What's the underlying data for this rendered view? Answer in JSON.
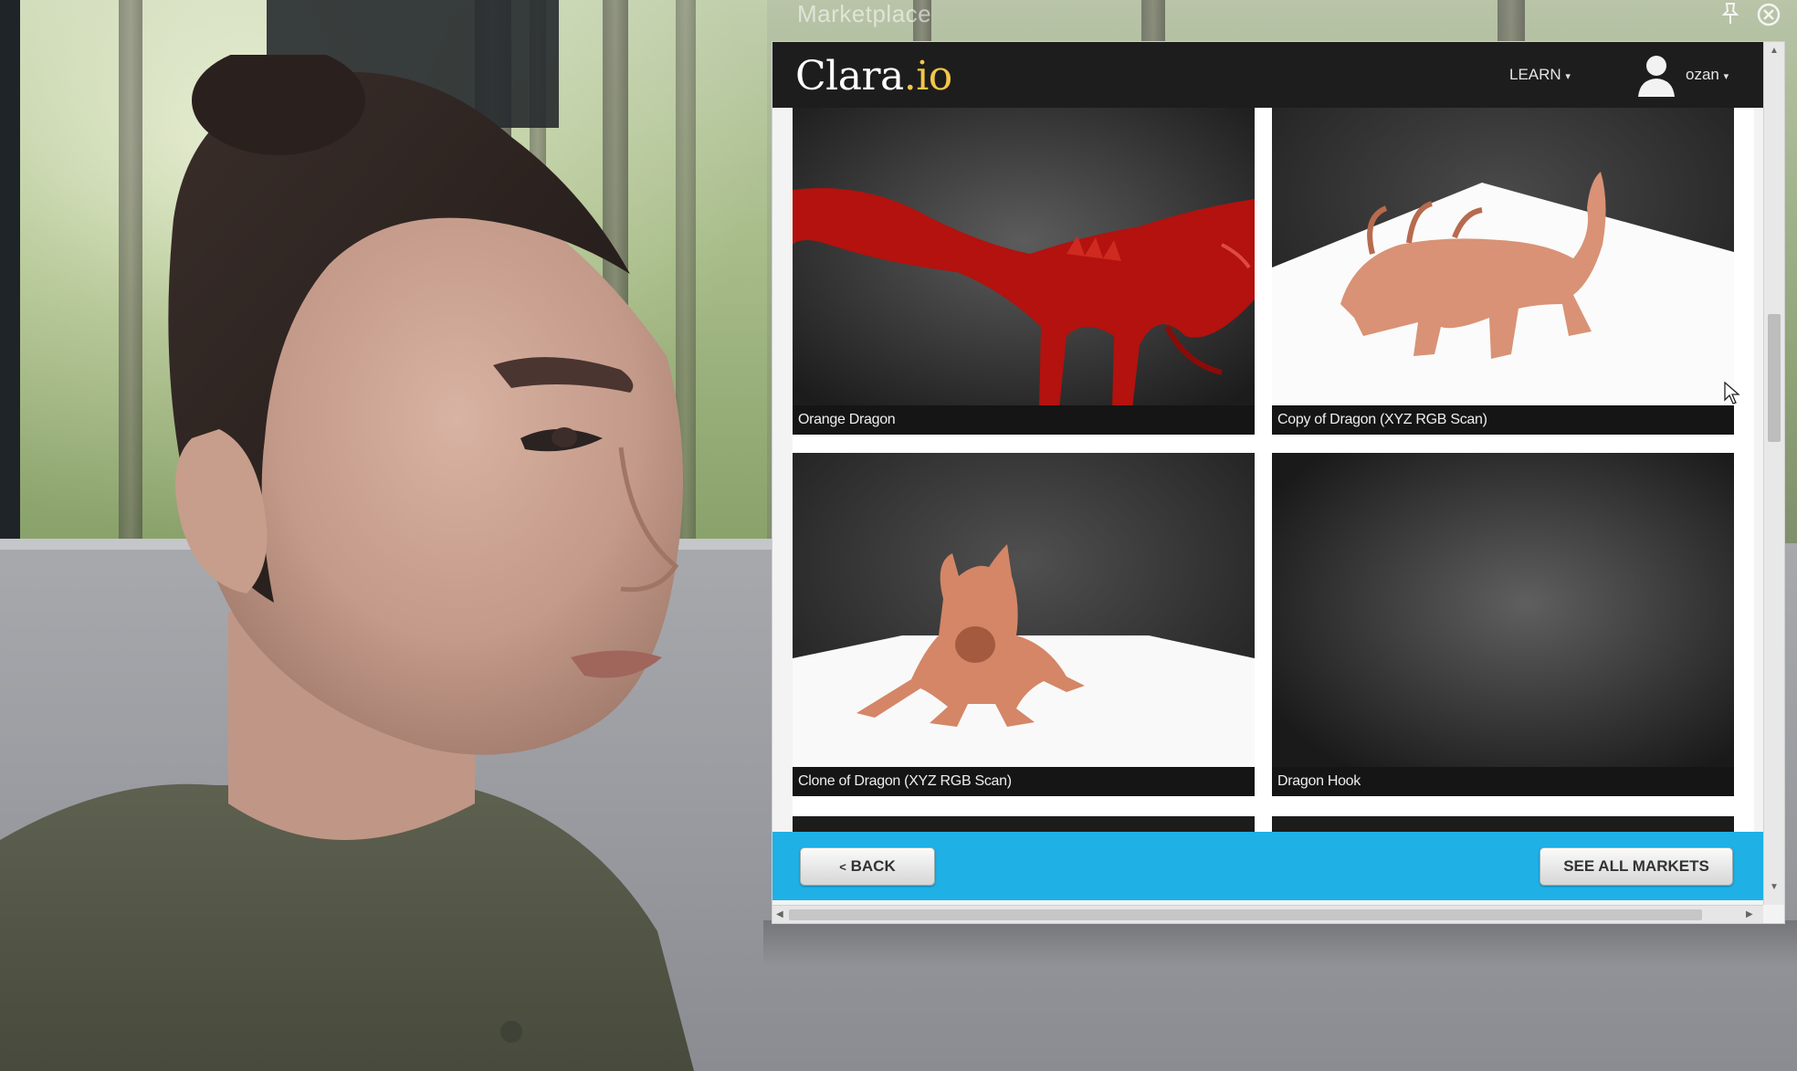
{
  "window": {
    "title": "Marketplace",
    "pin_icon": "pin-icon",
    "close_icon": "close-circle-icon"
  },
  "header": {
    "logo_main": "Clara",
    "logo_suffix": ".io",
    "learn_label": "LEARN",
    "user_name": "ozan",
    "avatar_icon": "user-silhouette-icon"
  },
  "models": [
    {
      "title": "Orange Dragon"
    },
    {
      "title": "Copy of Dragon (XYZ RGB Scan)"
    },
    {
      "title": "Clone of Dragon (XYZ RGB Scan)"
    },
    {
      "title": "Dragon Hook"
    }
  ],
  "footer": {
    "back_label": "BACK",
    "see_all_label": "SEE ALL MARKETS"
  },
  "colors": {
    "navbar": "#1d1d1d",
    "footer_band": "#1fb0e6",
    "logo_accent": "#f3c64a",
    "caption_bar": "#151515"
  }
}
